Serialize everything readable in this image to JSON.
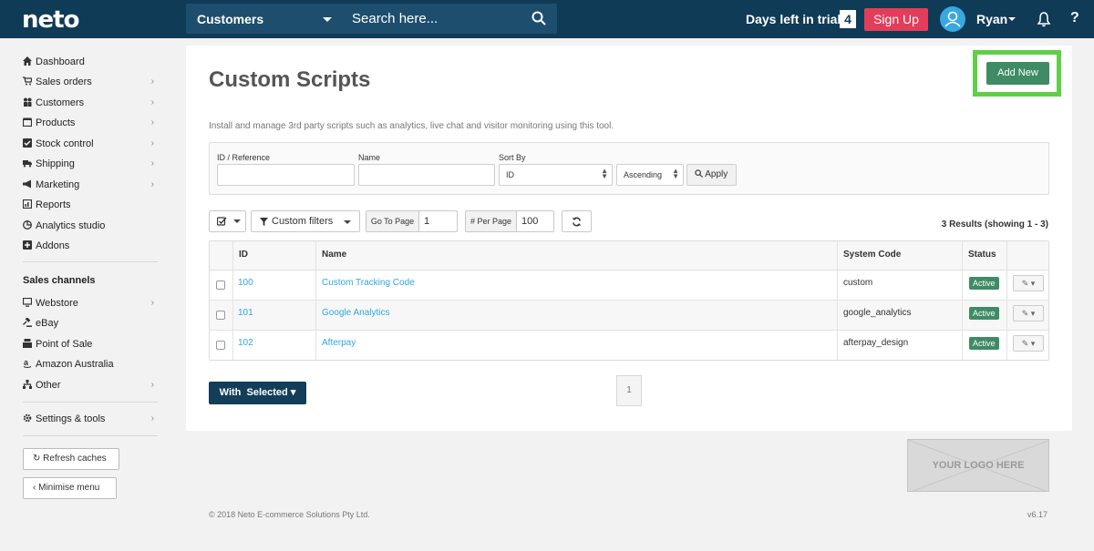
{
  "header": {
    "logo": "neto",
    "search_category": "Customers",
    "search_placeholder": "Search here...",
    "trial_label": "Days left in trial",
    "trial_days": "4",
    "signup_label": "Sign Up",
    "user_name": "Ryan",
    "help": "?"
  },
  "sidebar": {
    "items": [
      {
        "label": "Dashboard",
        "icon": "home-icon",
        "chevron": false
      },
      {
        "label": "Sales orders",
        "icon": "cart-icon",
        "chevron": true
      },
      {
        "label": "Customers",
        "icon": "users-icon",
        "chevron": true
      },
      {
        "label": "Products",
        "icon": "box-icon",
        "chevron": true
      },
      {
        "label": "Stock control",
        "icon": "stock-icon",
        "chevron": true
      },
      {
        "label": "Shipping",
        "icon": "truck-icon",
        "chevron": true
      },
      {
        "label": "Marketing",
        "icon": "megaphone-icon",
        "chevron": true
      },
      {
        "label": "Reports",
        "icon": "report-icon",
        "chevron": false
      },
      {
        "label": "Analytics studio",
        "icon": "analytics-icon",
        "chevron": false
      },
      {
        "label": "Addons",
        "icon": "plus-square-icon",
        "chevron": false
      }
    ],
    "channels_heading": "Sales channels",
    "channels": [
      {
        "label": "Webstore",
        "icon": "monitor-icon",
        "chevron": true
      },
      {
        "label": "eBay",
        "icon": "gavel-icon",
        "chevron": false
      },
      {
        "label": "Point of Sale",
        "icon": "register-icon",
        "chevron": false
      },
      {
        "label": "Amazon Australia",
        "icon": "amazon-icon",
        "chevron": false
      },
      {
        "label": "Other",
        "icon": "sitemap-icon",
        "chevron": true
      }
    ],
    "settings": {
      "label": "Settings & tools",
      "icon": "gear-icon",
      "chevron": true
    },
    "refresh_caches": "Refresh caches",
    "minimise_menu": "Minimise menu"
  },
  "main": {
    "title": "Custom Scripts",
    "add_new": "Add New",
    "description": "Install and manage 3rd party scripts such as analytics, live chat and visitor monitoring using this tool.",
    "filters": {
      "id_label": "ID / Reference",
      "name_label": "Name",
      "sort_label": "Sort By",
      "sort_value": "ID",
      "order_value": "Ascending",
      "apply": "Apply"
    },
    "toolbar": {
      "custom_filters": "Custom filters",
      "go_to_page_label": "Go To Page",
      "go_to_page_value": "1",
      "per_page_label": "# Per Page",
      "per_page_value": "100"
    },
    "results": "3 Results (showing 1 - 3)",
    "table": {
      "headers": [
        "ID",
        "Name",
        "System Code",
        "Status"
      ],
      "rows": [
        {
          "id": "100",
          "name": "Custom Tracking Code",
          "code": "custom",
          "status": "Active"
        },
        {
          "id": "101",
          "name": "Google Analytics",
          "code": "google_analytics",
          "status": "Active"
        },
        {
          "id": "102",
          "name": "Afterpay",
          "code": "afterpay_design",
          "status": "Active"
        }
      ]
    },
    "with_selected": "With  Selected",
    "page": "1"
  },
  "logo_placeholder": "YOUR LOGO HERE",
  "footer": {
    "copyright": "© 2018 Neto E-commerce Solutions Pty Ltd.",
    "version": "v6.17"
  },
  "colors": {
    "topbar": "#0f3b57",
    "accent_green": "#3f8b66",
    "highlight": "#5fcf46",
    "signup": "#e23d5a",
    "link": "#2ea7e0"
  }
}
